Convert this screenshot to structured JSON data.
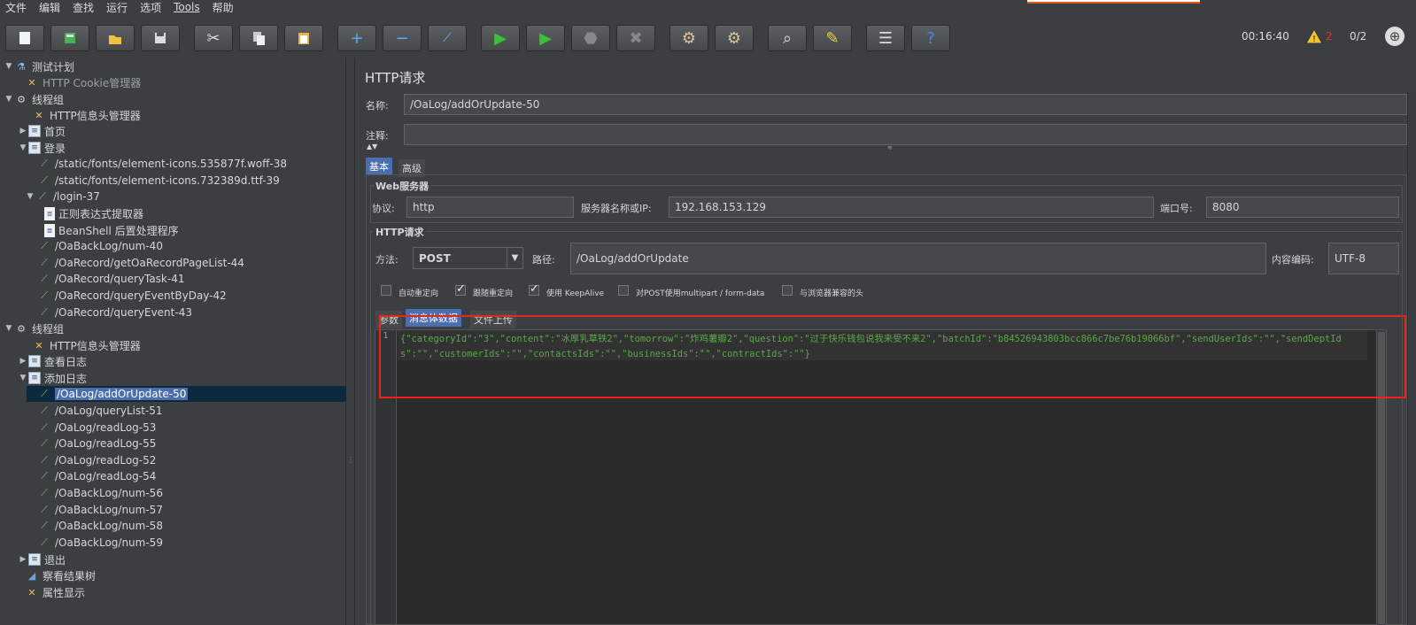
{
  "menu": [
    "文件",
    "编辑",
    "查找",
    "运行",
    "选项",
    "Tools",
    "帮助"
  ],
  "toolbar": {
    "buttons": [
      "new-icon",
      "templates-icon",
      "open-icon",
      "save-icon",
      "cut-icon",
      "copy-icon",
      "paste-icon",
      "expand-icon",
      "collapse-icon",
      "toggle-icon",
      "start-icon",
      "start-no-pause-icon",
      "stop-icon",
      "shutdown-icon",
      "clear-icon",
      "clear-all-icon",
      "search-icon",
      "reset-search-icon",
      "function-helper-icon",
      "help-icon"
    ],
    "timer": "00:16:40",
    "warning_count": "2",
    "threads": "0/2"
  },
  "tree": [
    {
      "label": "测试计划",
      "icon": "plan-icon",
      "toggle": "▼"
    },
    {
      "label": "HTTP Cookie管理器",
      "icon": "wrench-icon",
      "dim": true
    },
    {
      "label": "线程组",
      "icon": "gear-icon",
      "toggle": "▼"
    },
    {
      "label": "HTTP信息头管理器",
      "icon": "wrench-icon"
    },
    {
      "label": "首页",
      "icon": "controller-icon",
      "toggle": "▶"
    },
    {
      "label": "登录",
      "icon": "controller-icon",
      "toggle": "▼"
    },
    {
      "label": "/static/fonts/element-icons.535877f.woff-38",
      "icon": "sampler-icon"
    },
    {
      "label": "/static/fonts/element-icons.732389d.ttf-39",
      "icon": "sampler-icon"
    },
    {
      "label": "/login-37",
      "icon": "sampler-icon",
      "toggle": "▼"
    },
    {
      "label": "正则表达式提取器",
      "icon": "doc-icon"
    },
    {
      "label": "BeanShell 后置处理程序",
      "icon": "doc-icon"
    },
    {
      "label": "/OaBackLog/num-40",
      "icon": "sampler-icon"
    },
    {
      "label": "/OaRecord/getOaRecordPageList-44",
      "icon": "sampler-icon"
    },
    {
      "label": "/OaRecord/queryTask-41",
      "icon": "sampler-icon"
    },
    {
      "label": "/OaRecord/queryEventByDay-42",
      "icon": "sampler-icon"
    },
    {
      "label": "/OaRecord/queryEvent-43",
      "icon": "sampler-icon"
    },
    {
      "label": "线程组",
      "icon": "gear-icon",
      "toggle": "▼"
    },
    {
      "label": "HTTP信息头管理器",
      "icon": "wrench-icon"
    },
    {
      "label": "查看日志",
      "icon": "controller-icon",
      "toggle": "▶"
    },
    {
      "label": "添加日志",
      "icon": "controller-icon",
      "toggle": "▼"
    },
    {
      "label": "/OaLog/addOrUpdate-50",
      "icon": "sampler-icon",
      "selected": true
    },
    {
      "label": "/OaLog/queryList-51",
      "icon": "sampler-icon"
    },
    {
      "label": "/OaLog/readLog-53",
      "icon": "sampler-icon"
    },
    {
      "label": "/OaLog/readLog-55",
      "icon": "sampler-icon"
    },
    {
      "label": "/OaLog/readLog-52",
      "icon": "sampler-icon"
    },
    {
      "label": "/OaLog/readLog-54",
      "icon": "sampler-icon"
    },
    {
      "label": "/OaBackLog/num-56",
      "icon": "sampler-icon"
    },
    {
      "label": "/OaBackLog/num-57",
      "icon": "sampler-icon"
    },
    {
      "label": "/OaBackLog/num-58",
      "icon": "sampler-icon"
    },
    {
      "label": "/OaBackLog/num-59",
      "icon": "sampler-icon"
    },
    {
      "label": "退出",
      "icon": "controller-icon",
      "toggle": "▶"
    },
    {
      "label": "察看结果树",
      "icon": "chart-icon"
    },
    {
      "label": "属性显示",
      "icon": "wrench-icon"
    }
  ],
  "panel": {
    "title": "HTTP请求",
    "name_label": "名称:",
    "name_value": "/OaLog/addOrUpdate-50",
    "comment_label": "注释:",
    "comment_value": "",
    "tabs": [
      "基本",
      "高级"
    ],
    "web_server_title": "Web服务器",
    "protocol_label": "协议:",
    "protocol_value": "http",
    "server_label": "服务器名称或IP:",
    "server_value": "192.168.153.129",
    "port_label": "端口号:",
    "port_value": "8080",
    "http_request_title": "HTTP请求",
    "method_label": "方法:",
    "method_value": "POST",
    "path_label": "路径:",
    "path_value": "/OaLog/addOrUpdate",
    "encoding_label": "内容编码:",
    "encoding_value": "UTF-8",
    "checkboxes": [
      {
        "label": "自动重定向",
        "checked": false
      },
      {
        "label": "跟随重定向",
        "checked": true
      },
      {
        "label": "使用 KeepAlive",
        "checked": true
      },
      {
        "label": "对POST使用multipart / form-data",
        "checked": false
      },
      {
        "label": "与浏览器兼容的头",
        "checked": false
      }
    ],
    "subtabs": [
      "参数",
      "消息体数据",
      "文件上传"
    ],
    "body_line": "1",
    "body": "{\"categoryId\":\"3\",\"content\":\"冰厚乳草铁2\",\"tomorrow\":\"炸鸡薯瓣2\",\"question\":\"过于快乐钱包说我来受不来2\",\"batchId\":\"b84526943803bcc866c7be76b19066bf\",\"sendUserIds\":\"\",\"sendDeptIds\":\"\",\"customerIds\":\"\",\"contactsIds\":\"\",\"businessIds\":\"\",\"contractIds\":\"\"}"
  }
}
